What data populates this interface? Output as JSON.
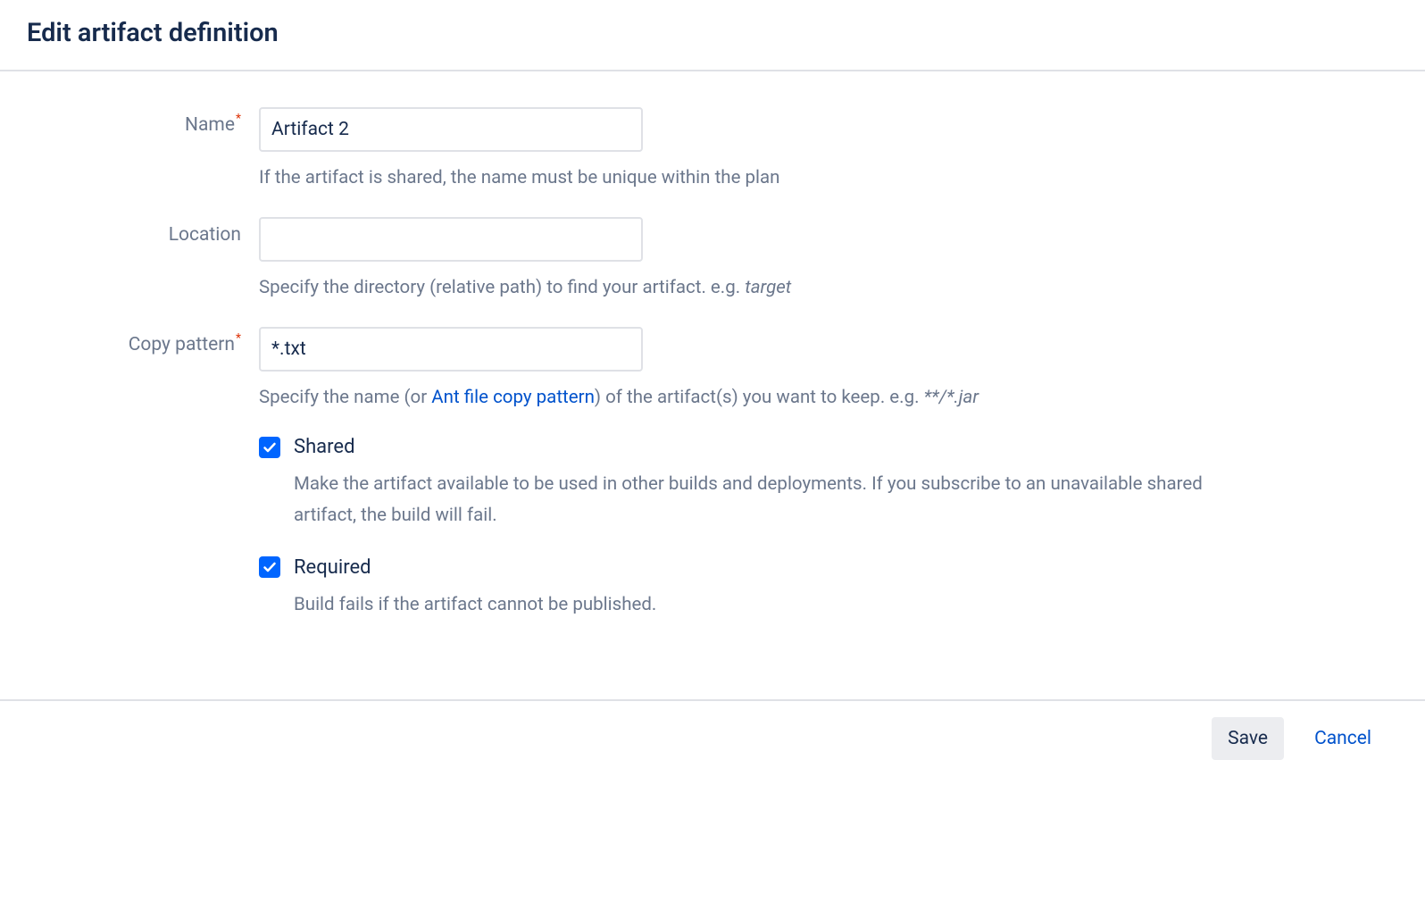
{
  "dialog": {
    "title": "Edit artifact definition"
  },
  "fields": {
    "name": {
      "label": "Name",
      "value": "Artifact 2",
      "helper": "If the artifact is shared, the name must be unique within the plan"
    },
    "location": {
      "label": "Location",
      "value": "",
      "helper_prefix": "Specify the directory (relative path) to find your artifact. e.g. ",
      "helper_eg": "target"
    },
    "copyPattern": {
      "label": "Copy pattern",
      "value": "*.txt",
      "helper_prefix": "Specify the name (or ",
      "helper_link": "Ant file copy pattern",
      "helper_mid": ") of the artifact(s) you want to keep. e.g. ",
      "helper_eg": "**/*.jar"
    },
    "shared": {
      "label": "Shared",
      "checked": true,
      "helper": "Make the artifact available to be used in other builds and deployments. If you subscribe to an unavailable shared artifact, the build will fail."
    },
    "required": {
      "label": "Required",
      "checked": true,
      "helper": "Build fails if the artifact cannot be published."
    }
  },
  "actions": {
    "save": "Save",
    "cancel": "Cancel"
  }
}
